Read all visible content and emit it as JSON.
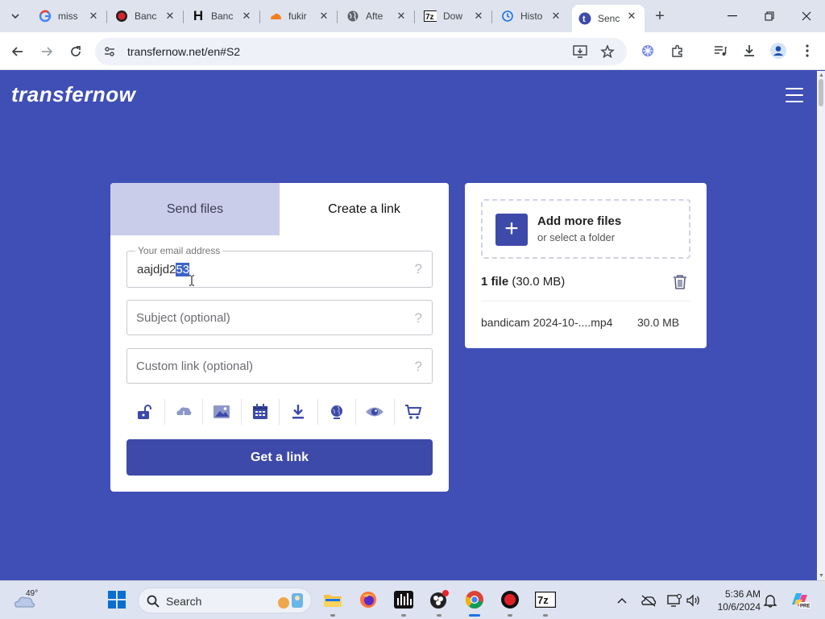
{
  "browser": {
    "tabs": [
      {
        "title": "miss",
        "favicon": "google-icon"
      },
      {
        "title": "Banc",
        "favicon": "bandicam-icon"
      },
      {
        "title": "Banc",
        "favicon": "h-icon"
      },
      {
        "title": "fukir",
        "favicon": "cloud-icon"
      },
      {
        "title": "Afte",
        "favicon": "globe-icon"
      },
      {
        "title": "Dow",
        "favicon": "7zip-icon"
      },
      {
        "title": "Histo",
        "favicon": "history-icon"
      },
      {
        "title": "Senc",
        "favicon": "transfernow-icon",
        "active": true
      }
    ],
    "url": "transfernow.net/en#S2"
  },
  "site": {
    "logo": "transfernow",
    "tabs": {
      "send": "Send files",
      "link": "Create a link"
    },
    "email": {
      "legend": "Your email address",
      "value_before": "aajdjd2",
      "value_selected": "53"
    },
    "subject_placeholder": "Subject (optional)",
    "custom_link_placeholder": "Custom link (optional)",
    "help_mark": "?",
    "option_icons": [
      "lock-icon",
      "cloud-icon",
      "image-icon",
      "calendar-icon",
      "download-icon",
      "globe-icon",
      "eye-icon",
      "cart-icon"
    ],
    "get_link_label": "Get a link",
    "add_files_title": "Add more files",
    "add_files_sub": "or select a folder",
    "file_count_bold": "1 file",
    "file_count_size": "(30.0 MB)",
    "file_name": "bandicam 2024-10-....mp4",
    "file_size": "30.0 MB",
    "accent": "#3d4aa9",
    "page_bg": "#3f4fb5"
  },
  "taskbar": {
    "temperature": "49°",
    "search_label": "Search",
    "time": "5:36 AM",
    "date": "10/6/2024"
  }
}
